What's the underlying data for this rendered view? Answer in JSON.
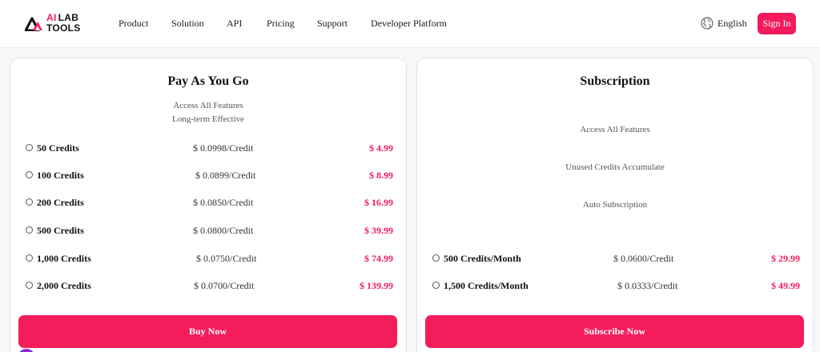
{
  "brand": {
    "line1_accent": "AI",
    "line1_rest": "LAB",
    "line2": "TOOLS"
  },
  "nav": {
    "items": [
      "Product",
      "Solution",
      "API",
      "Pricing",
      "Support",
      "Developer Platform"
    ],
    "language": "English",
    "sign_in": "Sign In"
  },
  "payg": {
    "title": "Pay As You Go",
    "features": [
      "Access All Features",
      "Long-term Effective"
    ],
    "options": [
      {
        "credits": "50 Credits",
        "unit": "$ 0.0998/Credit",
        "price": "$ 4.99"
      },
      {
        "credits": "100 Credits",
        "unit": "$ 0.0899/Credit",
        "price": "$ 8.99"
      },
      {
        "credits": "200 Credits",
        "unit": "$ 0.0850/Credit",
        "price": "$ 16.99"
      },
      {
        "credits": "500 Credits",
        "unit": "$ 0.0800/Credit",
        "price": "$ 39.99"
      },
      {
        "credits": "1,000 Credits",
        "unit": "$ 0.0750/Credit",
        "price": "$ 74.99"
      },
      {
        "credits": "2,000 Credits",
        "unit": "$ 0.0700/Credit",
        "price": "$ 139.99"
      }
    ],
    "button": "Buy Now"
  },
  "subscription": {
    "title": "Subscription",
    "features": [
      "Access All Features",
      "Unused Credits Accumulate",
      "Auto Subscription"
    ],
    "options": [
      {
        "credits": "500 Credits/Month",
        "unit": "$ 0.0600/Credit",
        "price": "$ 29.99"
      },
      {
        "credits": "1,500 Credits/Month",
        "unit": "$ 0.0333/Credit",
        "price": "$ 49.99"
      }
    ],
    "button": "Subscribe Now"
  },
  "colors": {
    "accent": "#f31b5b",
    "text": "#111111",
    "muted": "#555555",
    "border": "#e3e3e3"
  },
  "icons": {
    "logo": "triangle-logo-icon",
    "language": "globe-icon",
    "option": "radio-icon"
  }
}
